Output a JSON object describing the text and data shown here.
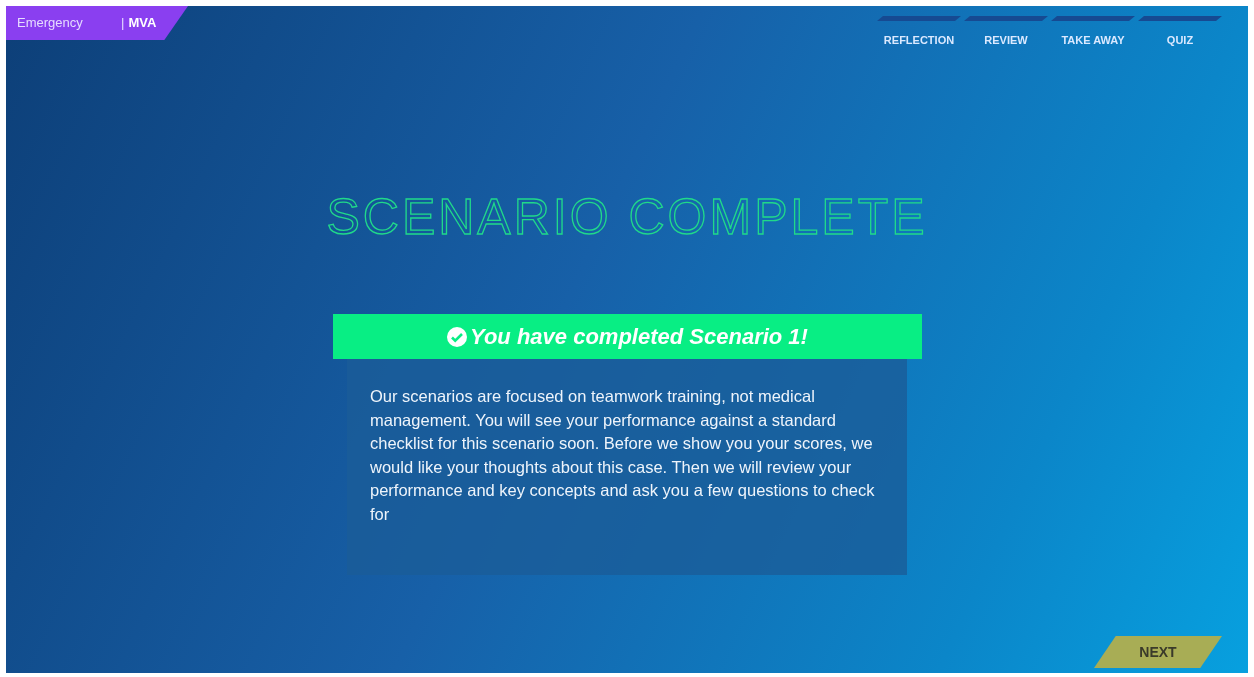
{
  "breadcrumb": {
    "category": "Emergency",
    "separator": "|",
    "scenario": "MVA"
  },
  "tabs": [
    {
      "label": "REFLECTION"
    },
    {
      "label": "REVIEW"
    },
    {
      "label": "TAKE AWAY"
    },
    {
      "label": "QUIZ"
    }
  ],
  "title": "SCENARIO COMPLETE",
  "banner": {
    "text": "You have completed Scenario 1!"
  },
  "message": "Our scenarios are focused on teamwork training, not medical management. You will see your performance against a standard checklist for this scenario soon. Before we show you your scores, we would like your thoughts about this case. Then we will review your performance and key concepts and ask you a few questions to check for",
  "next_button": "NEXT"
}
